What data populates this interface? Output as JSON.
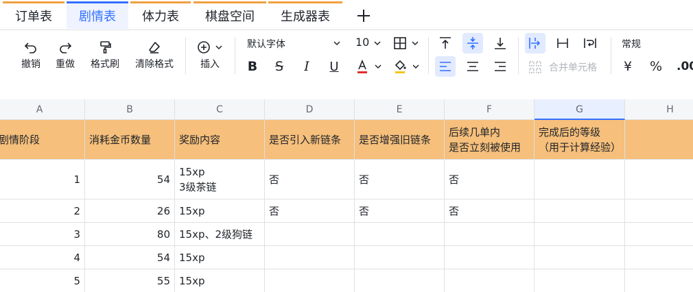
{
  "tabs": [
    {
      "label": "订单表",
      "active": false
    },
    {
      "label": "剧情表",
      "active": true
    },
    {
      "label": "体力表",
      "active": false
    },
    {
      "label": "棋盘空间",
      "active": false
    },
    {
      "label": "生成器表",
      "active": false
    }
  ],
  "add_tab_icon": "plus-icon",
  "toolbar": {
    "undo": "撤销",
    "redo": "重做",
    "format_painter": "格式刷",
    "clear_format": "清除格式",
    "insert": "插入",
    "font_family": "默认字体",
    "font_size": "10",
    "merge_cells": "合并单元格",
    "number_format": "常规",
    "currency_symbol": "¥",
    "percent_symbol": "%",
    "decimal_symbol": ".00"
  },
  "columns": [
    "A",
    "B",
    "C",
    "D",
    "E",
    "F",
    "G",
    "H"
  ],
  "selected_column": "G",
  "header_row": [
    "剧情阶段",
    "消耗金币数量",
    "奖励内容",
    "是否引入新链条",
    "是否增强旧链条",
    "后续几单内\n是否立刻被使用",
    "完成后的等级（用于计算经验）",
    ""
  ],
  "rows": [
    [
      "1",
      "54",
      "15xp\n3级茶链",
      "否",
      "否",
      "否",
      "",
      ""
    ],
    [
      "2",
      "26",
      "15xp",
      "否",
      "否",
      "否",
      "",
      ""
    ],
    [
      "3",
      "80",
      "15xp、2级狗链",
      "",
      "",
      "",
      "",
      ""
    ],
    [
      "4",
      "54",
      "15xp",
      "",
      "",
      "",
      "",
      ""
    ],
    [
      "5",
      "55",
      "15xp",
      "",
      "",
      "",
      "",
      ""
    ]
  ],
  "colors": {
    "accent": "#3370ff",
    "header_fill": "#f6bf7b",
    "tab_marker": "#f0a040"
  }
}
